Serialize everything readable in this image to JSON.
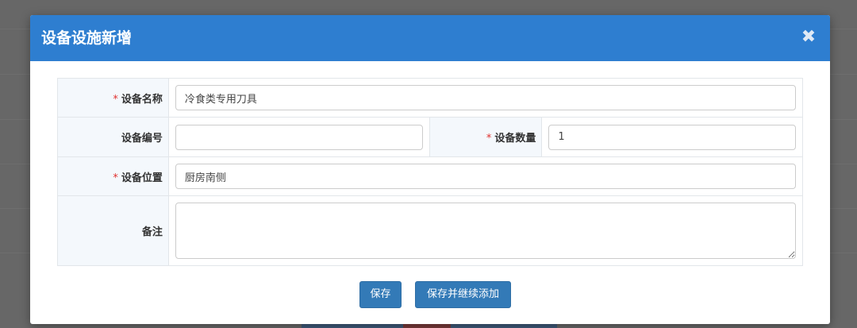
{
  "modal": {
    "title": "设备设施新增",
    "close_icon": "close-icon"
  },
  "form": {
    "name": {
      "label": "设备名称",
      "required": true,
      "required_mark": "*",
      "value": "冷食类专用刀具"
    },
    "code": {
      "label": "设备编号",
      "required": false,
      "value": ""
    },
    "quantity": {
      "label": "设备数量",
      "required": true,
      "required_mark": "*",
      "value": "1"
    },
    "location": {
      "label": "设备位置",
      "required": true,
      "required_mark": "*",
      "value": "厨房南侧"
    },
    "remark": {
      "label": "备注",
      "required": false,
      "value": ""
    }
  },
  "buttons": {
    "save_label": "保存",
    "save_continue_label": "保存并继续添加"
  },
  "colors": {
    "header": "#2e7ed0",
    "primary_button": "#337ab7",
    "required": "#e0302f",
    "label_bg": "#f4f8fc",
    "overlay": "#676767"
  }
}
